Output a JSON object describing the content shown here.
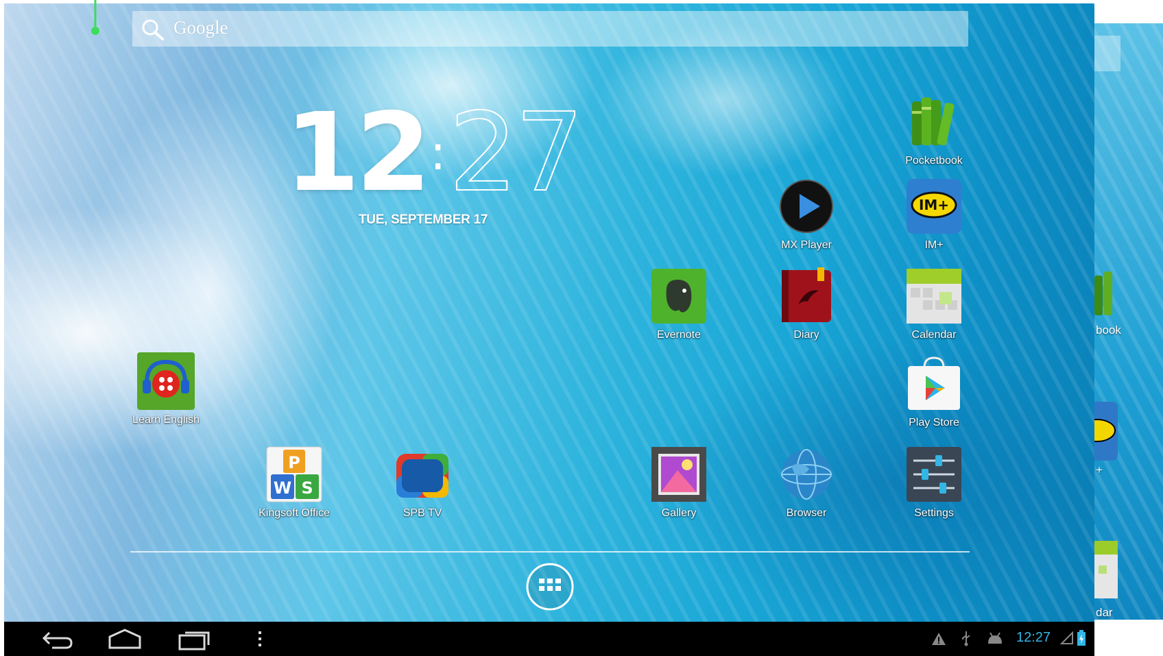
{
  "search": {
    "placeholder": "Google"
  },
  "clock": {
    "hours": "12",
    "separator": ":",
    "minutes": "27",
    "date": "TUE, SEPTEMBER 17"
  },
  "apps": [
    {
      "id": "pocketbook",
      "label": "Pocketbook"
    },
    {
      "id": "mx-player",
      "label": "MX Player"
    },
    {
      "id": "im-plus",
      "label": "IM+"
    },
    {
      "id": "evernote",
      "label": "Evernote"
    },
    {
      "id": "diary",
      "label": "Diary"
    },
    {
      "id": "calendar",
      "label": "Calendar"
    },
    {
      "id": "learn-english",
      "label": "Learn English"
    },
    {
      "id": "play-store",
      "label": "Play Store"
    },
    {
      "id": "kingsoft-office",
      "label": "Kingsoft Office"
    },
    {
      "id": "spb-tv",
      "label": "SPB TV"
    },
    {
      "id": "gallery",
      "label": "Gallery"
    },
    {
      "id": "browser",
      "label": "Browser"
    },
    {
      "id": "settings",
      "label": "Settings"
    }
  ],
  "peek_screen": {
    "labels": [
      "book",
      "+",
      "dar"
    ]
  },
  "statusbar": {
    "time": "12:27"
  },
  "icons": [
    "search-icon",
    "back-icon",
    "home-icon",
    "recents-icon",
    "menu-icon",
    "warning-icon",
    "usb-icon",
    "android-debug-icon",
    "signal-icon",
    "battery-icon",
    "app-drawer-icon"
  ],
  "colors": {
    "status_time": "#33b5e5",
    "navbar": "#000000"
  }
}
